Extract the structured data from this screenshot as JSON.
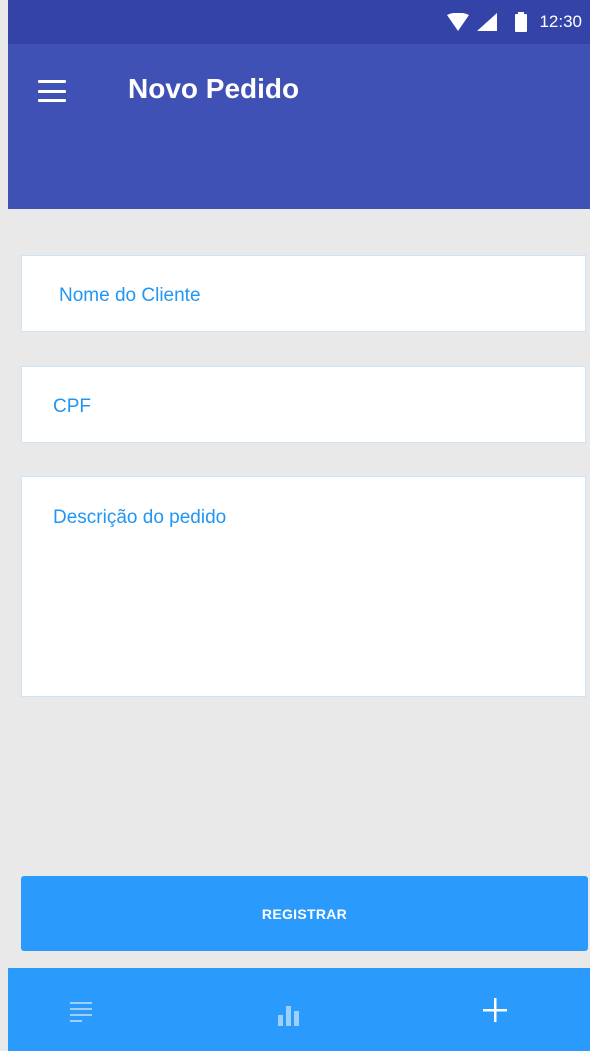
{
  "status_bar": {
    "time": "12:30"
  },
  "app_bar": {
    "title": "Novo Pedido"
  },
  "form": {
    "client_name_placeholder": "Nome do Cliente",
    "cpf_placeholder": "CPF",
    "description_placeholder": "Descrição do pedido",
    "submit_label": "REGISTRAR"
  },
  "bottom_nav": {
    "items": [
      {
        "icon": "list-icon",
        "active": false
      },
      {
        "icon": "bar-chart-icon",
        "active": false
      },
      {
        "icon": "plus-icon",
        "active": true
      }
    ]
  },
  "colors": {
    "status_bar": "#3343a8",
    "app_bar": "#3f51b5",
    "accent": "#2a9bfd",
    "placeholder_text": "#2196f3",
    "background": "#e9e9e9"
  }
}
